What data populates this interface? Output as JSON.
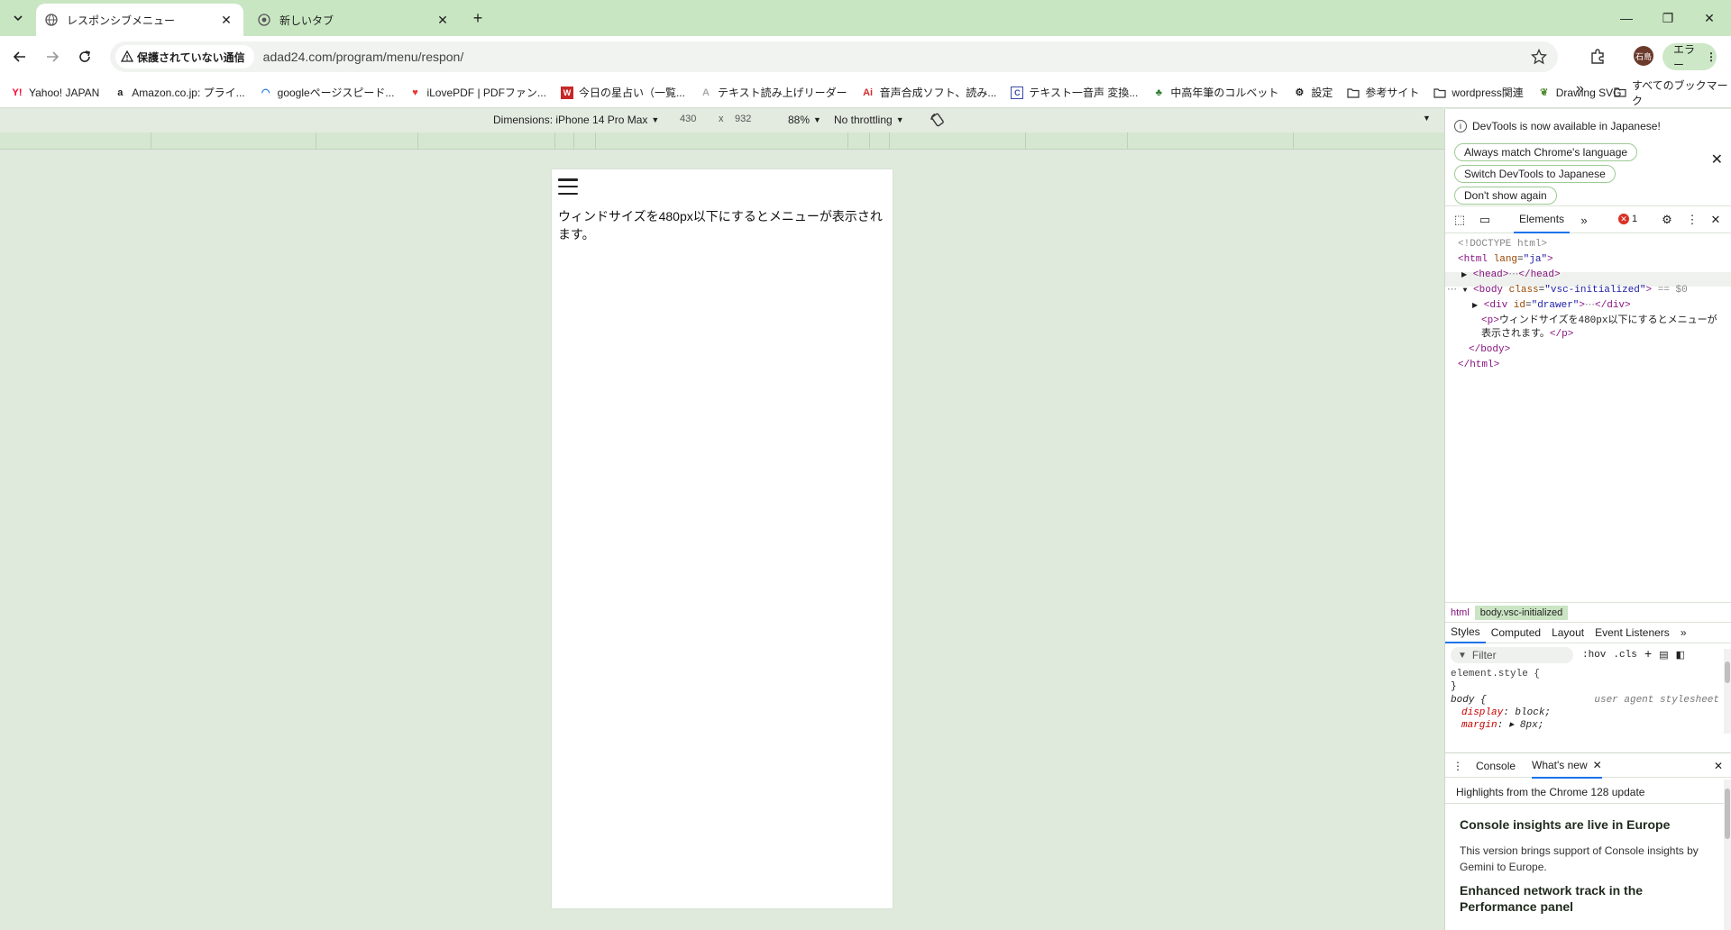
{
  "browser": {
    "tabs": [
      {
        "title": "レスポンシブメニュー",
        "active": true
      },
      {
        "title": "新しいタブ",
        "active": false
      }
    ],
    "address": {
      "security_label": "保護されていない通信",
      "url": "adad24.com/program/menu/respon/"
    },
    "profile_initials": "石島",
    "error_chip_label": "エラー"
  },
  "bookmarks": [
    {
      "label": "Yahoo! JAPAN",
      "icon": "yahoo-icon"
    },
    {
      "label": "Amazon.co.jp: プライ...",
      "icon": "amazon-icon"
    },
    {
      "label": "googleページスピード...",
      "icon": "pagespeed-icon"
    },
    {
      "label": "iLovePDF | PDFファン...",
      "icon": "heart-icon"
    },
    {
      "label": "今日の星占い（一覧...",
      "icon": "horoscope-icon"
    },
    {
      "label": "テキスト読み上げリーダー",
      "icon": "reader-icon"
    },
    {
      "label": "音声合成ソフト、読み...",
      "icon": "ai-icon"
    },
    {
      "label": "テキスト一音声 変換...",
      "icon": "c-icon"
    },
    {
      "label": "中高年筆のコルベット",
      "icon": "frog-icon"
    },
    {
      "label": "設定",
      "icon": "gear-icon"
    },
    {
      "label": "参考サイト",
      "icon": "folder-icon"
    },
    {
      "label": "wordpress関連",
      "icon": "folder-icon"
    },
    {
      "label": "Drawing SVG",
      "icon": "leaf-icon"
    }
  ],
  "bookmarks_all": "すべてのブックマーク",
  "device_toolbar": {
    "dimensions_label": "Dimensions: iPhone 14 Pro Max",
    "width": "430",
    "times": "x",
    "height": "932",
    "zoom": "88%",
    "throttle": "No throttling"
  },
  "page": {
    "text": "ウィンドサイズを480px以下にするとメニューが表示されます。"
  },
  "devtools": {
    "banner": {
      "message": "DevTools is now available in Japanese!",
      "buttons": [
        "Always match Chrome's language",
        "Switch DevTools to Japanese",
        "Don't show again"
      ]
    },
    "panel_tab": "Elements",
    "error_count": "1",
    "dom": {
      "doctype": "<!DOCTYPE html>",
      "html_open_tag": "<html",
      "html_attr_name": "lang",
      "html_attr_value": "\"ja\"",
      "head": "<head>",
      "head_close": "</head>",
      "body_tag": "<body",
      "body_attr_name": "class",
      "body_attr_value": "\"vsc-initialized\"",
      "body_marker": "== $0",
      "div_tag": "<div",
      "div_attr_name": "id",
      "div_attr_value": "\"drawer\"",
      "div_close": "</div>",
      "p_open": "<p>",
      "p_text_1": "ウィンドサイズを480px以下にするとメニューが",
      "p_text_2": "表示されます。",
      "p_close": "</p>",
      "body_close": "</body>",
      "html_close": "</html>"
    },
    "breadcrumbs": [
      "html",
      "body.vsc-initialized"
    ],
    "styles_tabs": [
      "Styles",
      "Computed",
      "Layout",
      "Event Listeners"
    ],
    "filter_placeholder": "Filter",
    "filter_tools": [
      ":hov",
      ".cls"
    ],
    "styles": {
      "element_style": "element.style {",
      "close_brace": "}",
      "body_selector": "body {",
      "ua_label": "user agent stylesheet",
      "prop1_name": "display",
      "prop1_value": ": block;",
      "prop2_name": "margin",
      "prop2_value": ": ▸ 8px;"
    },
    "drawer_tabs": [
      "Console",
      "What's new"
    ],
    "whats_new": {
      "highlights": "Highlights from the Chrome 128 update",
      "h1": "Console insights are live in Europe",
      "p1": "This version brings support of Console insights by Gemini to Europe.",
      "h2": "Enhanced network track in the Performance panel"
    }
  }
}
